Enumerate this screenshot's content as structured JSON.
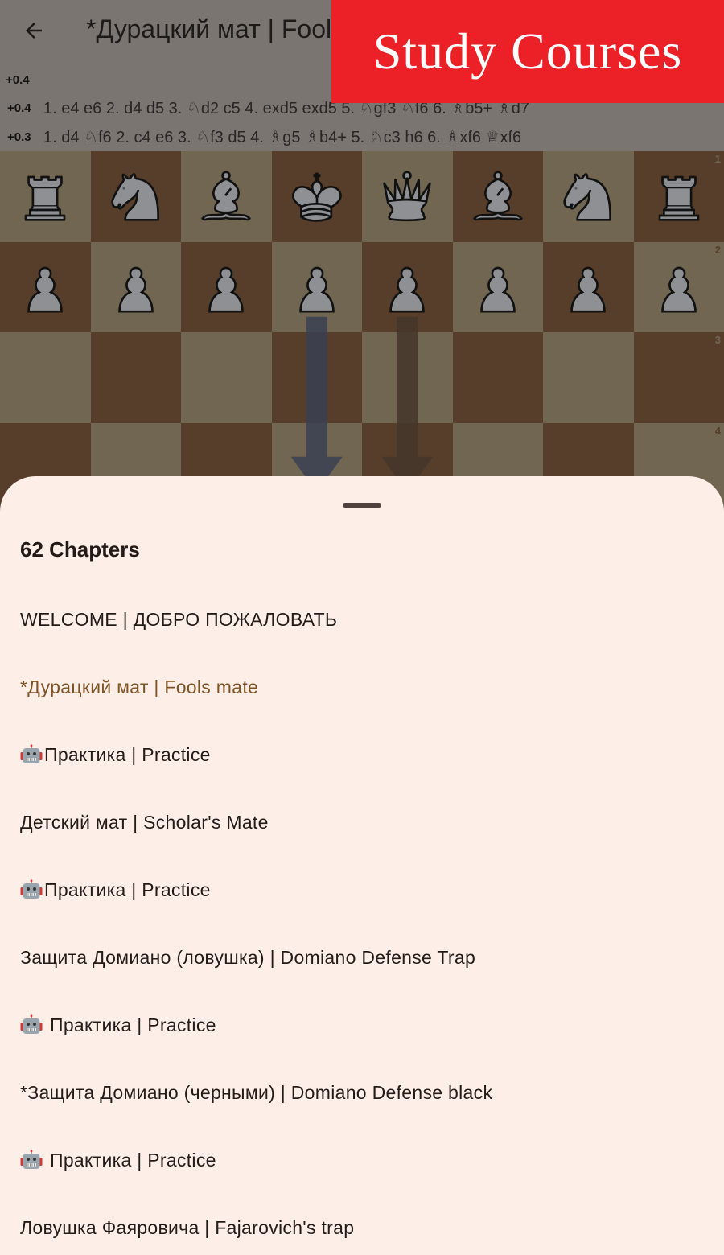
{
  "appbar": {
    "back_icon": "arrow-left-icon",
    "title": "*Дурацкий мат | Fools mate"
  },
  "engine": {
    "lines": [
      {
        "score": "+0.4",
        "moves": ""
      },
      {
        "score": "+0.4",
        "moves": "1. e4 e6 2. d4 d5 3. ♘d2 c5 4. exd5 exd5 5. ♘gf3 ♘f6 6. ♗b5+ ♗d7"
      },
      {
        "score": "+0.3",
        "moves": "1. d4 ♘f6 2. c4 e6 3. ♘f3 d5 4. ♗g5 ♗b4+ 5. ♘c3 h6 6. ♗xf6 ♕xf6"
      }
    ]
  },
  "board": {
    "orientation": "black",
    "colors": {
      "light": "#706651",
      "dark": "#573e2b"
    },
    "rank_labels": [
      "1",
      "2",
      "3",
      "4"
    ],
    "rows": [
      [
        "rook",
        "knight",
        "bishop",
        "king",
        "queen",
        "bishop",
        "knight",
        "rook"
      ],
      [
        "pawn",
        "pawn",
        "pawn",
        "pawn",
        "pawn",
        "pawn",
        "pawn",
        "pawn"
      ],
      [
        "",
        "",
        "",
        "",
        "",
        "",
        "",
        ""
      ],
      [
        "",
        "",
        "",
        "",
        "",
        "",
        "",
        ""
      ]
    ],
    "piece_color": "white",
    "arrows": [
      {
        "from": "e2",
        "to": "e4",
        "color": "#3a3f52"
      },
      {
        "from": "d2",
        "to": "d4",
        "color": "#44352a"
      }
    ]
  },
  "sheet": {
    "title": "62 Chapters",
    "chapters": [
      {
        "label": "WELCOME | ДОБРО ПОЖАЛОВАТЬ",
        "icon": "",
        "active": false
      },
      {
        "label": "*Дурацкий мат | Fools mate",
        "icon": "",
        "active": true
      },
      {
        "label": "Практика | Practice",
        "icon": "robot-icon",
        "icon_spaced": false,
        "active": false
      },
      {
        "label": "Детский мат | Scholar's Mate",
        "icon": "",
        "active": false
      },
      {
        "label": "Практика | Practice",
        "icon": "robot-icon",
        "icon_spaced": false,
        "active": false
      },
      {
        "label": "Защита Домиано (ловушка) | Domiano Defense Trap",
        "icon": "",
        "active": false
      },
      {
        "label": "Практика | Practice",
        "icon": "robot-icon",
        "icon_spaced": true,
        "active": false
      },
      {
        "label": "*Защита Домиано (черными) | Domiano Defense black",
        "icon": "",
        "active": false
      },
      {
        "label": "Практика | Practice",
        "icon": "robot-icon",
        "icon_spaced": true,
        "active": false
      },
      {
        "label": "Ловушка Фаяровича | Fajarovich's trap",
        "icon": "",
        "active": false
      }
    ],
    "active_color": "#7e5223"
  },
  "banner": {
    "text": "Study Courses",
    "color": "#ec2027"
  }
}
